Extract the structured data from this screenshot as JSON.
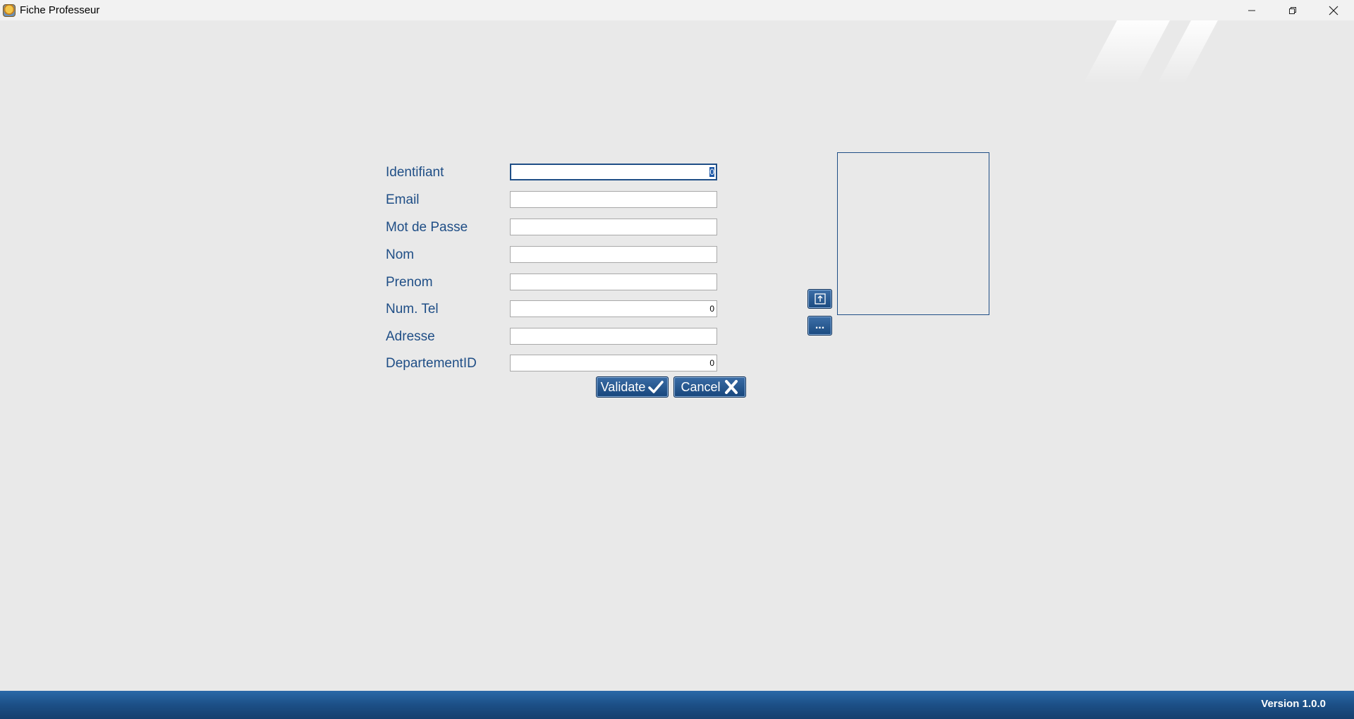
{
  "window": {
    "title": "Fiche Professeur",
    "icon": "app-icon",
    "controls": {
      "minimize_icon": "minimize-icon",
      "restore_icon": "restore-icon",
      "close_icon": "close-icon"
    }
  },
  "form": {
    "fields": [
      {
        "label": "Identifiant",
        "value": "0",
        "placeholder": ""
      },
      {
        "label": "Email",
        "value": "",
        "placeholder": ""
      },
      {
        "label": "Mot de Passe",
        "value": "",
        "placeholder": ""
      },
      {
        "label": "Nom",
        "value": "",
        "placeholder": ""
      },
      {
        "label": "Prenom",
        "value": "",
        "placeholder": ""
      },
      {
        "label": "Num. Tel",
        "value": "0",
        "placeholder": ""
      },
      {
        "label": "Adresse",
        "value": "",
        "placeholder": ""
      },
      {
        "label": "DepartementID",
        "value": "0",
        "placeholder": ""
      }
    ]
  },
  "photo": {
    "load_button_icon": "image-upload-icon",
    "browse_label": "..."
  },
  "actions": {
    "validate_label": "Validate",
    "validate_icon": "check-icon",
    "cancel_label": "Cancel",
    "cancel_icon": "x-icon"
  },
  "status": {
    "version": "Version 1.0.0"
  },
  "colors": {
    "accent": "#1f4e86",
    "background": "#e9e9e9",
    "statusbar": "#1c4f86"
  }
}
